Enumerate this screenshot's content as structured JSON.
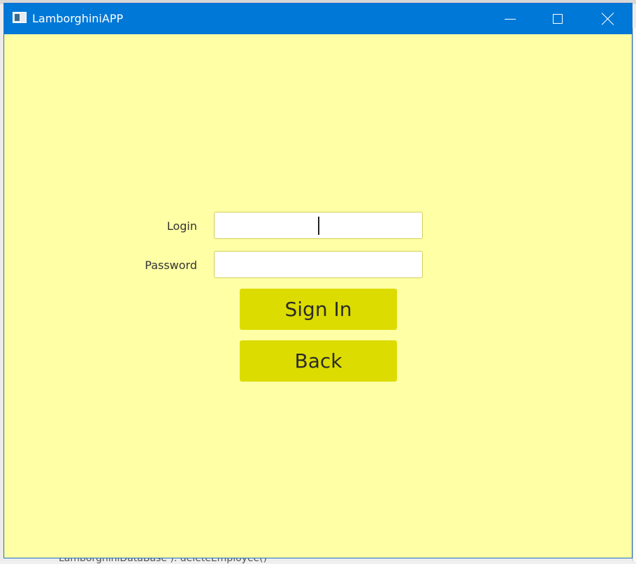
{
  "window": {
    "title": "LamborghiniAPP",
    "icon": "java-app-icon",
    "controls": {
      "minimize": "minimize-icon",
      "maximize": "maximize-icon",
      "close": "close-icon"
    }
  },
  "form": {
    "login_label": "Login",
    "login_value": "",
    "password_label": "Password",
    "password_value": "",
    "signin_label": "Sign In",
    "back_label": "Back"
  },
  "background": {
    "code_snippet": "LamborghiniDataBase ). deleteEmployee()"
  },
  "colors": {
    "titlebar": "#0078d7",
    "window_background": "#ffffa6",
    "button": "#dcdc00",
    "input_border": "#d4cf55"
  }
}
